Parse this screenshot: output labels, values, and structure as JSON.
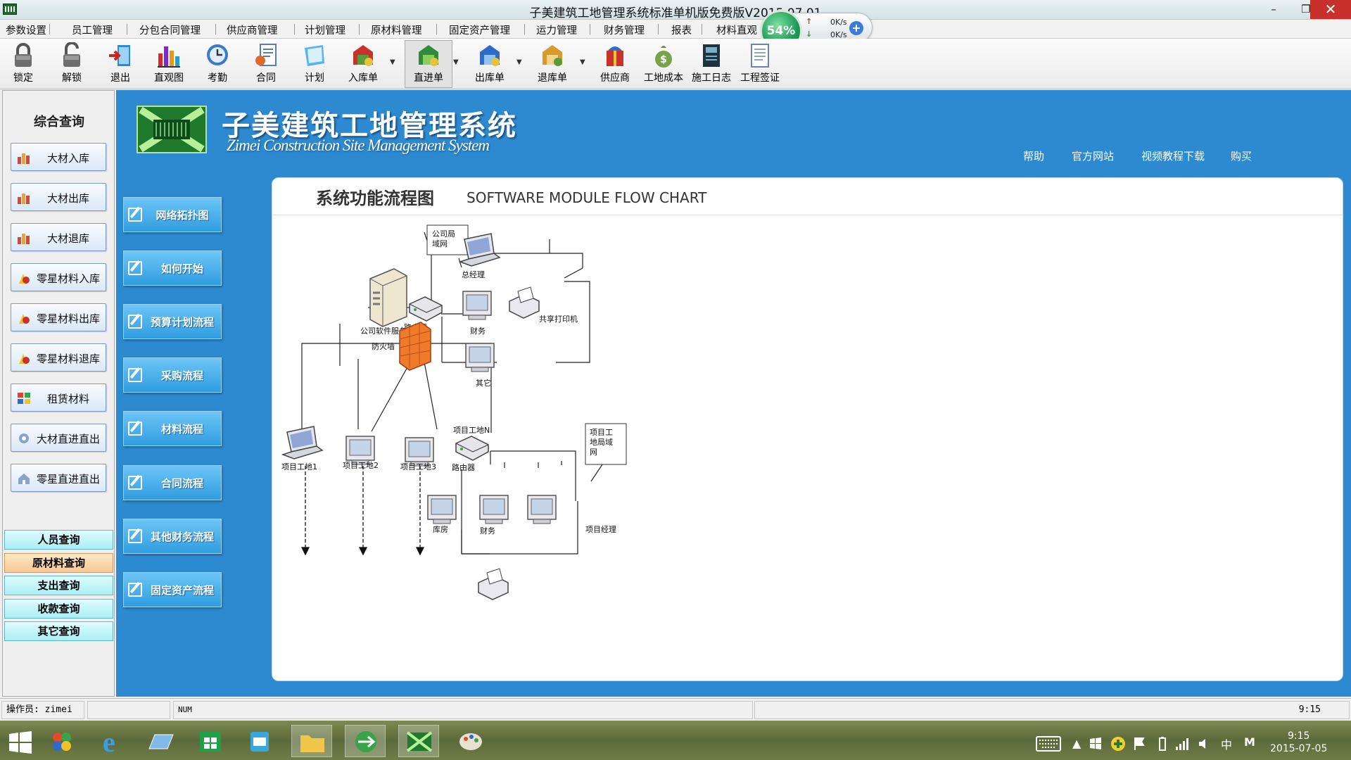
{
  "window": {
    "title": "子美建筑工地管理系统标准单机版免费版V2015.07.01",
    "minimize": "–",
    "maximize": "❐",
    "close": "✕"
  },
  "menu": [
    "参数设置",
    "员工管理",
    "分包合同管理",
    "供应商管理",
    "计划管理",
    "原材料管理",
    "固定资产管理",
    "运力管理",
    "财务管理",
    "报表",
    "材料直观"
  ],
  "net_widget": {
    "cpu": "54%",
    "up": "0K/s",
    "down": "0K/s"
  },
  "toolbar": [
    {
      "label": "锁定",
      "icon": "lock-icon"
    },
    {
      "label": "解锁",
      "icon": "unlock-icon"
    },
    {
      "label": "退出",
      "icon": "exit-icon"
    },
    {
      "label": "直观图",
      "icon": "bar-chart-icon"
    },
    {
      "label": "考勤",
      "icon": "attendance-icon"
    },
    {
      "label": "合同",
      "icon": "contract-icon"
    },
    {
      "label": "计划",
      "icon": "plan-icon"
    },
    {
      "label": "入库单",
      "icon": "inbound-icon"
    },
    {
      "label": "直进单",
      "icon": "direct-in-icon"
    },
    {
      "label": "出库单",
      "icon": "outbound-icon"
    },
    {
      "label": "退库单",
      "icon": "return-icon"
    },
    {
      "label": "供应商",
      "icon": "supplier-icon"
    },
    {
      "label": "工地成本",
      "icon": "cost-icon"
    },
    {
      "label": "施工日志",
      "icon": "log-icon"
    },
    {
      "label": "工程签证",
      "icon": "visa-icon"
    }
  ],
  "sidebar": {
    "title": "综合查询",
    "items": [
      "大材入库",
      "大材出库",
      "大材退库",
      "零星材料入库",
      "零星材料出库",
      "零星材料退库",
      "租赁材料",
      "大材直进直出",
      "零星直进直出"
    ],
    "queries": [
      "人员查询",
      "原材料查询",
      "支出查询",
      "收款查询",
      "其它查询"
    ]
  },
  "header": {
    "title_cn": "子美建筑工地管理系统",
    "title_en": "Zimei Construction Site Management System",
    "links": [
      "帮助",
      "官方网站",
      "视频教程下载",
      "购买"
    ]
  },
  "functions": [
    "网络拓扑图",
    "如何开始",
    "预算计划流程",
    "采购流程",
    "材料流程",
    "合同流程",
    "其他财务流程",
    "固定资产流程"
  ],
  "content": {
    "title_cn": "系统功能流程图",
    "title_en": "SOFTWARE MODULE FLOW CHART"
  },
  "diagram": {
    "company_lan": "公司局域网",
    "gm": "总经理",
    "server": "公司软件服务器",
    "router1": "路由器",
    "finance1": "财务",
    "printer": "共享打印机",
    "other": "其它",
    "firewall": "防火墙",
    "site1": "项目工地1",
    "site2": "项目工地2",
    "site3": "项目工地3",
    "siteN": "项目工地N",
    "router2": "路由器",
    "site_lan": "项目工地局域网",
    "warehouse": "库房",
    "finance2": "财务",
    "pm": "项目经理"
  },
  "status": {
    "operator": "操作员: zimei",
    "num": "NUM",
    "time": "9:15"
  },
  "clock": {
    "time": "9:15",
    "date": "2015-07-05"
  },
  "tray": {
    "ime": "中",
    "m": "M"
  }
}
